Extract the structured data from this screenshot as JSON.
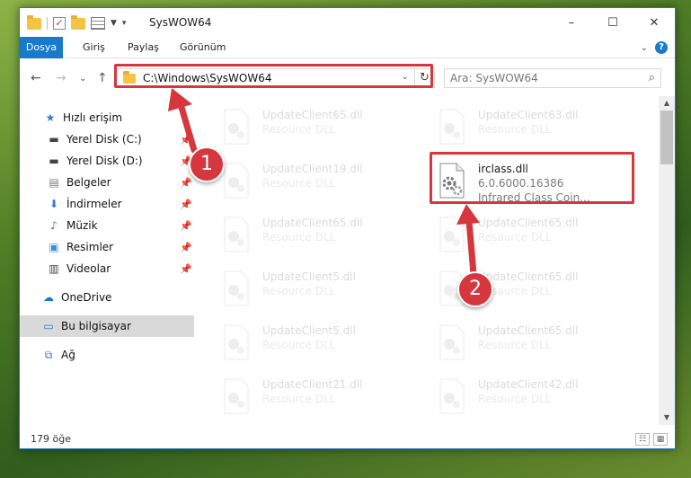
{
  "window": {
    "title": "SysWOW64",
    "controls": {
      "minimize": "–",
      "maximize": "☐",
      "close": "✕"
    }
  },
  "ribbon": {
    "tabs": [
      "Dosya",
      "Giriş",
      "Paylaş",
      "Görünüm"
    ],
    "expand": "⌄",
    "help": "?"
  },
  "nav": {
    "back": "←",
    "forward": "→",
    "recent": "⌄",
    "up": "↑",
    "address": "C:\\Windows\\SysWOW64",
    "refresh": "↻",
    "search_placeholder": "Ara: SysWOW64"
  },
  "sidebar": {
    "quick_access": "Hızlı erişim",
    "items": [
      {
        "label": "Yerel Disk (C:)",
        "icon": "drive-icon"
      },
      {
        "label": "Yerel Disk (D:)",
        "icon": "drive-icon"
      },
      {
        "label": "Belgeler",
        "icon": "documents-icon"
      },
      {
        "label": "İndirmeler",
        "icon": "downloads-icon"
      },
      {
        "label": "Müzik",
        "icon": "music-icon"
      },
      {
        "label": "Resimler",
        "icon": "pictures-icon"
      },
      {
        "label": "Videolar",
        "icon": "videos-icon"
      }
    ],
    "onedrive": "OneDrive",
    "this_pc": "Bu bilgisayar",
    "network": "Ağ"
  },
  "files": [
    {
      "name": "UpdateClient65.dll",
      "type": "Resource DLL"
    },
    {
      "name": "UpdateClient63.dll",
      "type": "Resource DLL"
    },
    {
      "name": "UpdateClient19.dll",
      "type": "Resource DLL"
    },
    {
      "name": "irclass.dll",
      "type": "6.0.6000.16386",
      "desc": "Infrared Class Coin..."
    },
    {
      "name": "UpdateClient65.dll",
      "type": "Resource DLL"
    },
    {
      "name": "UpdateClient65.dll",
      "type": "Resource DLL"
    },
    {
      "name": "UpdateClient5.dll",
      "type": "Resource DLL"
    },
    {
      "name": "UpdateClient65.dll",
      "type": "Resource DLL"
    },
    {
      "name": "UpdateClient5.dll",
      "type": "Resource DLL"
    },
    {
      "name": "UpdateClient65.dll",
      "type": "Resource DLL"
    },
    {
      "name": "UpdateClient21.dll",
      "type": "Resource DLL"
    },
    {
      "name": "UpdateClient42.dll",
      "type": "Resource DLL"
    }
  ],
  "status": {
    "count": "179 öğe"
  },
  "annotations": {
    "step1": "1",
    "step2": "2",
    "color": "#d6363d"
  },
  "colors": {
    "accent": "#1979ca",
    "highlight": "#d6363d"
  }
}
